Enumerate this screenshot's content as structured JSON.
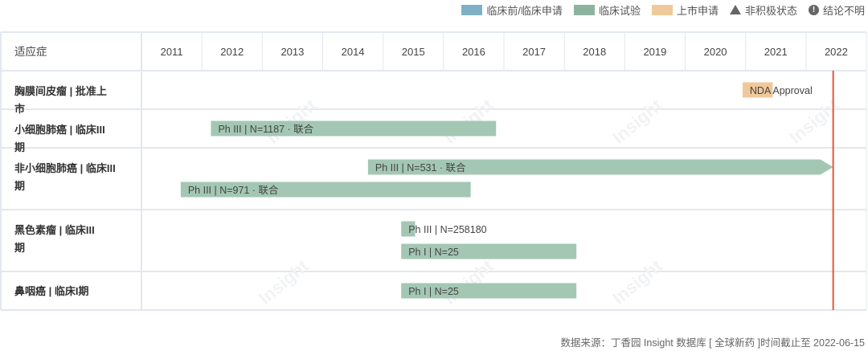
{
  "legend": [
    {
      "label": "临床前/临床申请",
      "type": "swatch",
      "color": "#7fb0c8"
    },
    {
      "label": "临床试验",
      "type": "swatch",
      "color": "#8db39e"
    },
    {
      "label": "上市申请",
      "type": "swatch",
      "color": "#f0c99a"
    },
    {
      "label": "非积极状态",
      "type": "triangle",
      "color": "#666666"
    },
    {
      "label": "结论不明",
      "type": "exclaim",
      "color": "#666666"
    }
  ],
  "header": {
    "indication": "适应症"
  },
  "watermark": "Insight",
  "source": "数据来源：丁香园 Insight 数据库 [ 全球新药 ]时间截止至 2022-06-15",
  "chart_data": {
    "type": "gantt",
    "years": [
      "2011",
      "2012",
      "2013",
      "2014",
      "2015",
      "2016",
      "2017",
      "2018",
      "2019",
      "2020",
      "2021",
      "2022"
    ],
    "xlim": [
      2011,
      2023
    ],
    "cutoff": 2022.45,
    "cutoff_color": "#e8553a",
    "rows": [
      {
        "label": "胸膜间皮瘤 | 批准上市",
        "bars": [
          {
            "label": "NDA Approval",
            "start": 2020.95,
            "end": 2021.45,
            "phase": "NDA",
            "color": "#f0c99a"
          }
        ]
      },
      {
        "label": "小细胞肺癌 | 临床III期",
        "bars": [
          {
            "label": "Ph III | N=1187 · 联合",
            "start": 2012.15,
            "end": 2016.87,
            "phase": "clinical",
            "color": "#a3c7b3"
          }
        ]
      },
      {
        "label": "非小细胞肺癌 | 临床III期",
        "bars": [
          {
            "label": "Ph III | N=531 · 联合",
            "start": 2014.75,
            "end": 2022.45,
            "phase": "clinical",
            "color": "#a3c7b3",
            "ongoing": true
          },
          {
            "label": "Ph III | N=971 · 联合",
            "start": 2011.65,
            "end": 2016.45,
            "phase": "clinical",
            "color": "#a3c7b3"
          }
        ]
      },
      {
        "label": "黑色素瘤 | 临床III期",
        "bars": [
          {
            "label": "Ph III | N=258180",
            "start": 2015.3,
            "end": 2015.53,
            "phase": "clinical",
            "color": "#a3c7b3"
          },
          {
            "label": "Ph I | N=25",
            "start": 2015.3,
            "end": 2018.2,
            "phase": "clinical",
            "color": "#a3c7b3"
          }
        ]
      },
      {
        "label": "鼻咽癌 | 临床I期",
        "bars": [
          {
            "label": "Ph I | N=25",
            "start": 2015.3,
            "end": 2018.2,
            "phase": "clinical",
            "color": "#a3c7b3"
          }
        ]
      }
    ]
  }
}
